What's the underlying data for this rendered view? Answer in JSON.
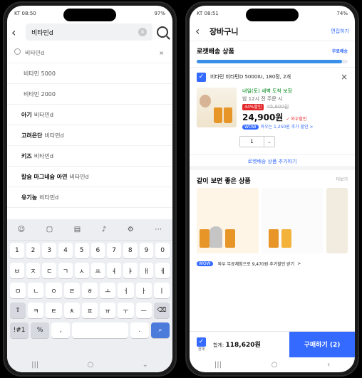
{
  "left": {
    "status": {
      "time": "KT 08:50",
      "right": "97%"
    },
    "search": {
      "query": "비타민d"
    },
    "recent": {
      "label": "비타민d"
    },
    "suggestions": [
      {
        "bold": "",
        "text": "비타민 5000"
      },
      {
        "bold": "",
        "text": "비타민 2000"
      },
      {
        "bold": "아기",
        "text": "비타민d"
      },
      {
        "bold": "고려은단",
        "text": "비타민d"
      },
      {
        "bold": "키즈",
        "text": "비타민d"
      },
      {
        "bold": "칼슘 마그네슘 아연",
        "text": "비타민d"
      },
      {
        "bold": "유기농",
        "text": "비타민d"
      }
    ],
    "keyboard": {
      "row1": [
        "1",
        "2",
        "3",
        "4",
        "5",
        "6",
        "7",
        "8",
        "9",
        "0"
      ],
      "row2": [
        "ㅂ",
        "ㅈ",
        "ㄷ",
        "ㄱ",
        "ㅅ",
        "ㅛ",
        "ㅕ",
        "ㅑ",
        "ㅐ",
        "ㅔ"
      ],
      "row3": [
        "ㅁ",
        "ㄴ",
        "ㅇ",
        "ㄹ",
        "ㅎ",
        "ㅗ",
        "ㅓ",
        "ㅏ",
        "ㅣ"
      ],
      "row4": [
        "⇧",
        "ㅋ",
        "ㅌ",
        "ㅊ",
        "ㅍ",
        "ㅠ",
        "ㅜ",
        "ㅡ",
        "⌫"
      ],
      "row5": [
        "!#1",
        "%",
        ",",
        "",
        ".",
        " Q"
      ]
    }
  },
  "right": {
    "status": {
      "time": "KT 08:51",
      "right": "74%"
    },
    "header": {
      "title": "장바구니",
      "edit": "편집하기"
    },
    "rocket": {
      "title": "로켓배송 상품",
      "badge": "무료배송",
      "progress": 0.96
    },
    "item": {
      "name": "비타민 비타민D 5000IU, 180정, 2개",
      "delivery": "내일(토) 새벽 도착 보장",
      "deadline": "밤 12시 전 주문 시",
      "discount": "44%할인",
      "orig_price": "45,600원",
      "price": "24,900원",
      "coupon": "✓ 와우할인",
      "card_badge": "WOW",
      "card_text": "와우는 1,250원 추가 할인 >",
      "qty": "1"
    },
    "more_link": "로켓배송 상품 추가하기",
    "reco": {
      "title": "같이 보면 좋은 상품",
      "more": "더보기"
    },
    "wow": {
      "badge": "WOW",
      "text": "와우 무료체험으로 9,470원 추가할인 받기",
      "arrow": ">"
    },
    "bottom": {
      "all": "전체",
      "total_label": "합계:",
      "total": "118,620원",
      "buy": "구매하기 (2)"
    }
  }
}
